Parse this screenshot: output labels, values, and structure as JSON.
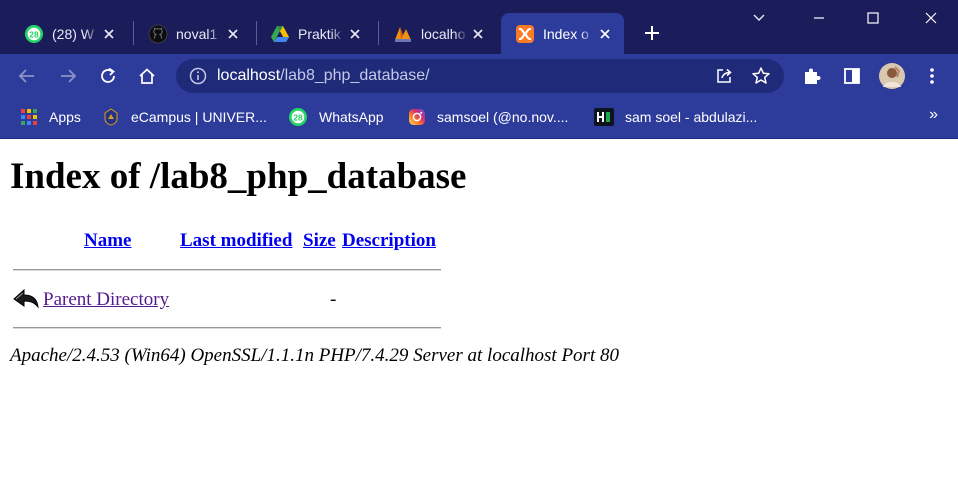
{
  "browser": {
    "tabs": [
      {
        "title": "(28) W",
        "icon": "whatsapp-icon",
        "badge": "28",
        "active": false
      },
      {
        "title": "noval1",
        "icon": "github-icon",
        "active": false
      },
      {
        "title": "Praktik",
        "icon": "google-drive-icon",
        "active": false
      },
      {
        "title": "localho",
        "icon": "phpmyadmin-icon",
        "active": false
      },
      {
        "title": "Index o",
        "icon": "xampp-icon",
        "active": true
      }
    ],
    "new_tab": "+",
    "address_bar": {
      "host": "localhost",
      "path": "/lab8_php_database/"
    },
    "bookmarks": [
      {
        "label": "Apps",
        "icon": "apps-grid-icon"
      },
      {
        "label": "eCampus | UNIVER...",
        "icon": "university-icon"
      },
      {
        "label": "WhatsApp",
        "icon": "whatsapp-icon",
        "badge": "28"
      },
      {
        "label": "samsoel (@no.nov....",
        "icon": "instagram-icon"
      },
      {
        "label": "sam soel - abdulazi...",
        "icon": "hackerrank-icon"
      }
    ],
    "bookmarks_overflow": "»",
    "colors": {
      "tab_strip": "#1b1d5a",
      "toolbar": "#2d3b9b",
      "omnibox": "#1f2a78"
    }
  },
  "page": {
    "heading": "Index of /lab8_php_database",
    "columns": {
      "name": "Name",
      "last_modified": "Last modified",
      "size": "Size",
      "description": "Description"
    },
    "rows": [
      {
        "name": "Parent Directory",
        "last_modified": "",
        "size": "-",
        "description": "",
        "icon": "back-arrow-icon"
      }
    ],
    "address": "Apache/2.4.53 (Win64) OpenSSL/1.1.1n PHP/7.4.29 Server at localhost Port 80",
    "colors": {
      "link": "#0000ee",
      "visited_link": "#551a8b"
    }
  }
}
